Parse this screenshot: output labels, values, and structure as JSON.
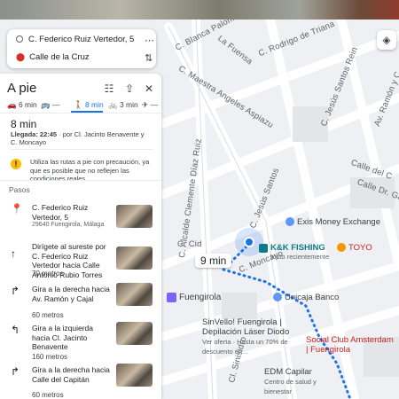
{
  "route": {
    "origin": "C. Federico Ruiz Vertedor, 5",
    "destination": "Calle de la Cruz"
  },
  "panel": {
    "title": "A pie",
    "modes": [
      {
        "icon": "car-icon",
        "label": "6 min"
      },
      {
        "icon": "bus-icon",
        "label": "—"
      },
      {
        "icon": "walk-icon",
        "label": "8 min"
      },
      {
        "icon": "bike-icon",
        "label": "3 min"
      },
      {
        "icon": "plane-icon",
        "label": "—"
      }
    ],
    "summary_time": "8 min",
    "arrival": "Llegada: 22:45",
    "via": " · por Cl. Jacinto Benavente y C. Moncayo",
    "warning": "Utiliza las rutas a pie con precaución, ya que es posible que no reflejen las condiciones reales.",
    "steps_heading": "Pasos",
    "steps": [
      {
        "icon": "pin-icon",
        "text": "C. Federico Ruiz Vertedor, 5",
        "sub": "29640 Fuengirola, Málaga",
        "distance": ""
      },
      {
        "icon": "arrow-up-icon",
        "text": "Dirígete al sureste por C. Federico Ruiz Vertedor hacia Calle Antonio Rubio Torres",
        "sub": "",
        "distance": "70 metros"
      },
      {
        "icon": "turn-right-icon",
        "text": "Gira a la derecha hacia Av. Ramón y Cajal",
        "sub": "",
        "distance": "60 metros"
      },
      {
        "icon": "turn-left-icon",
        "text": "Gira a la izquierda hacia Cl. Jacinto Benavente",
        "sub": "",
        "distance": "160 metros"
      },
      {
        "icon": "turn-right-icon",
        "text": "Gira a la derecha hacia Calle del Capitán",
        "sub": "",
        "distance": "60 metros"
      }
    ]
  },
  "map": {
    "route_time": "9 min",
    "streets": [
      "C. Blanca Paloma",
      "La Fuensa",
      "C. Rodrigo de Triana",
      "C. Maestra Angeles Aspiazu",
      "C. Jesús Santos Rein",
      "C. Jesús Santos",
      "C. Alcalde Clemente Díaz Ruiz",
      "Av. Ramón y C",
      "Calle del C",
      "Calle Dr. Galve",
      "C. Cid",
      "Fuengirola",
      "C. Moncayo",
      "Cl. Sinisidro"
    ],
    "pois": [
      {
        "name": "Exis Money Exchange",
        "sub": ""
      },
      {
        "name": "K&K FISHING",
        "sub": "Visto recientemente"
      },
      {
        "name": "TOYO",
        "sub": ""
      },
      {
        "name": "Unicaja Banco",
        "sub": ""
      },
      {
        "name": "Fuengirola",
        "sub": ""
      },
      {
        "name": "SinVello! Fuengirola | Depilación Láser Diodo",
        "sub": "Ver oferta · Hasta un 70% de descuento en..."
      },
      {
        "name": "Social Club Amsterdam | Fuengirola",
        "sub": ""
      },
      {
        "name": "EDM Capilar",
        "sub": "Centro de salud y bienestar"
      }
    ],
    "colors": {
      "route": "#1a73e8",
      "walk_active": "#1a73e8",
      "warning": "#fbbc04"
    }
  }
}
